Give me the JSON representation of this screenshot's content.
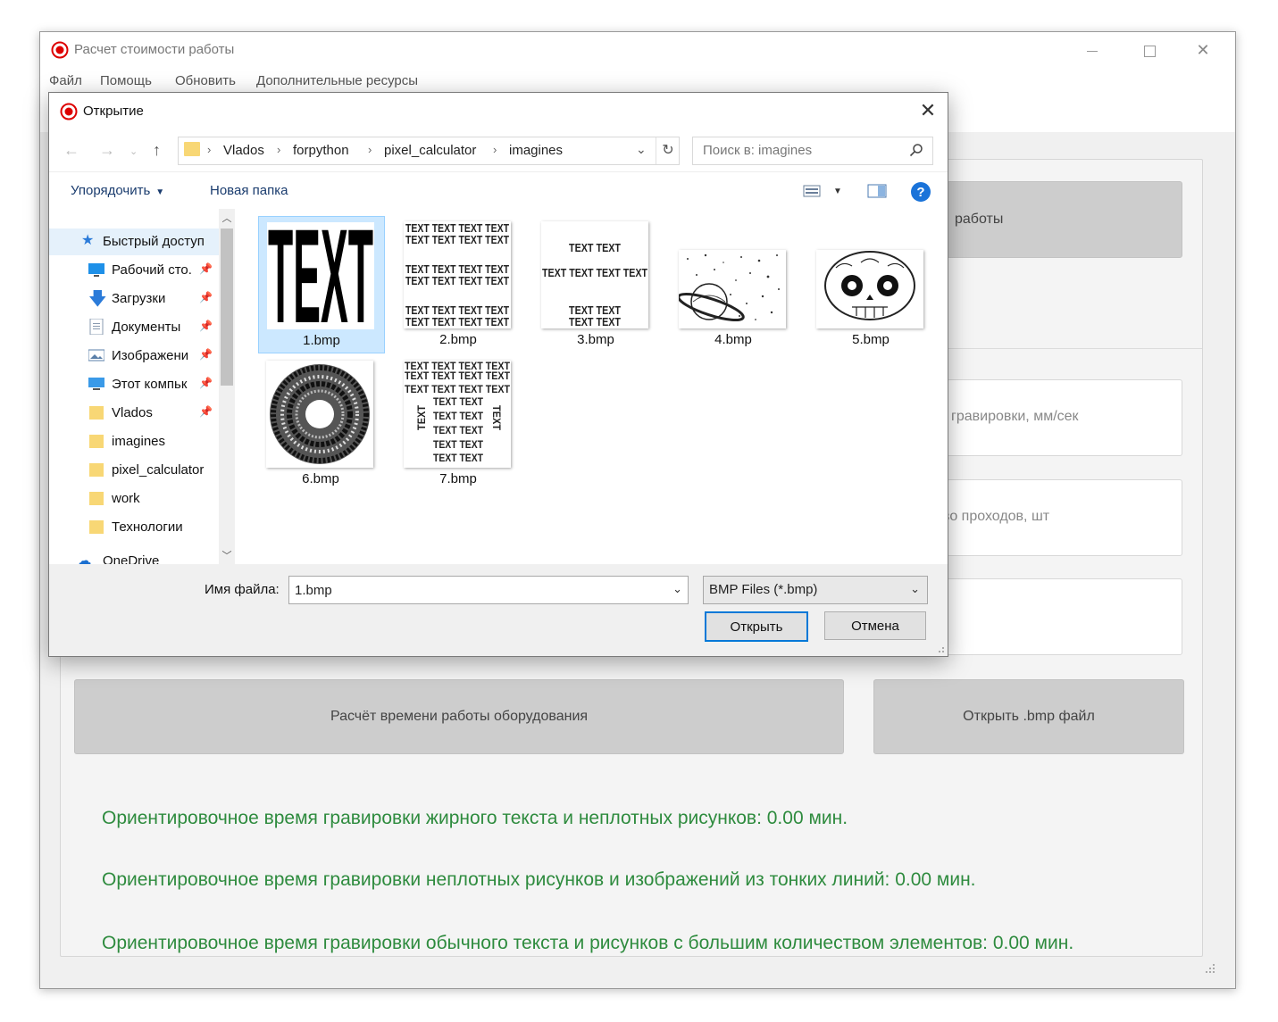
{
  "app": {
    "title": "Расчет стоимости работы",
    "menu": [
      "Файл",
      "Помощь",
      "Обновить",
      "Дополнительные ресурсы"
    ],
    "panel": {
      "button_top_partial": "работы",
      "input1_partial": "гравировки, мм/сек",
      "input2_partial": "во проходов, шт",
      "calc_button": "Расчёт времени работы оборудования",
      "open_bmp_button": "Открыть .bmp файл",
      "result_lines": [
        "Ориентировочное время гравировки жирного текста и неплотных рисунков: 0.00  мин.",
        "Ориентировочное время гравировки неплотных рисунков и изображений из тонких линий: 0.00  мин.",
        "Ориентировочное время гравировки обычного текста и рисунков с большим количеством элементов: 0.00  мин."
      ]
    },
    "accent_green": "#2e8b3e"
  },
  "dialog": {
    "title": "Открытие",
    "breadcrumb": [
      "Vlados",
      "forpython",
      "pixel_calculator",
      "imagines"
    ],
    "search_placeholder": "Поиск в: imagines",
    "organize": "Упорядочить",
    "new_folder": "Новая папка",
    "sidebar": [
      {
        "label": "Быстрый доступ",
        "icon": "star-icon"
      },
      {
        "label": "Рабочий сто.",
        "icon": "desktop-icon",
        "pinned": true
      },
      {
        "label": "Загрузки",
        "icon": "download-icon",
        "pinned": true
      },
      {
        "label": "Документы",
        "icon": "document-icon",
        "pinned": true
      },
      {
        "label": "Изображени",
        "icon": "image-icon",
        "pinned": true
      },
      {
        "label": "Этот компьк",
        "icon": "computer-icon",
        "pinned": true
      },
      {
        "label": "Vlados",
        "icon": "folder-icon",
        "pinned": true
      },
      {
        "label": "imagines",
        "icon": "folder-icon"
      },
      {
        "label": "pixel_calculator",
        "icon": "folder-icon"
      },
      {
        "label": "work",
        "icon": "folder-icon"
      },
      {
        "label": "Технологии",
        "icon": "folder-icon"
      },
      {
        "label": "OneDrive",
        "icon": "cloud-icon"
      }
    ],
    "files": [
      {
        "name": "1.bmp",
        "selected": true
      },
      {
        "name": "2.bmp"
      },
      {
        "name": "3.bmp"
      },
      {
        "name": "4.bmp"
      },
      {
        "name": "5.bmp"
      },
      {
        "name": "6.bmp"
      },
      {
        "name": "7.bmp"
      }
    ],
    "thumb_text": "TEXT",
    "filename_label": "Имя файла:",
    "filename_value": "1.bmp",
    "filetype": "BMP Files (*.bmp)",
    "open_button": "Открыть",
    "cancel_button": "Отмена"
  }
}
